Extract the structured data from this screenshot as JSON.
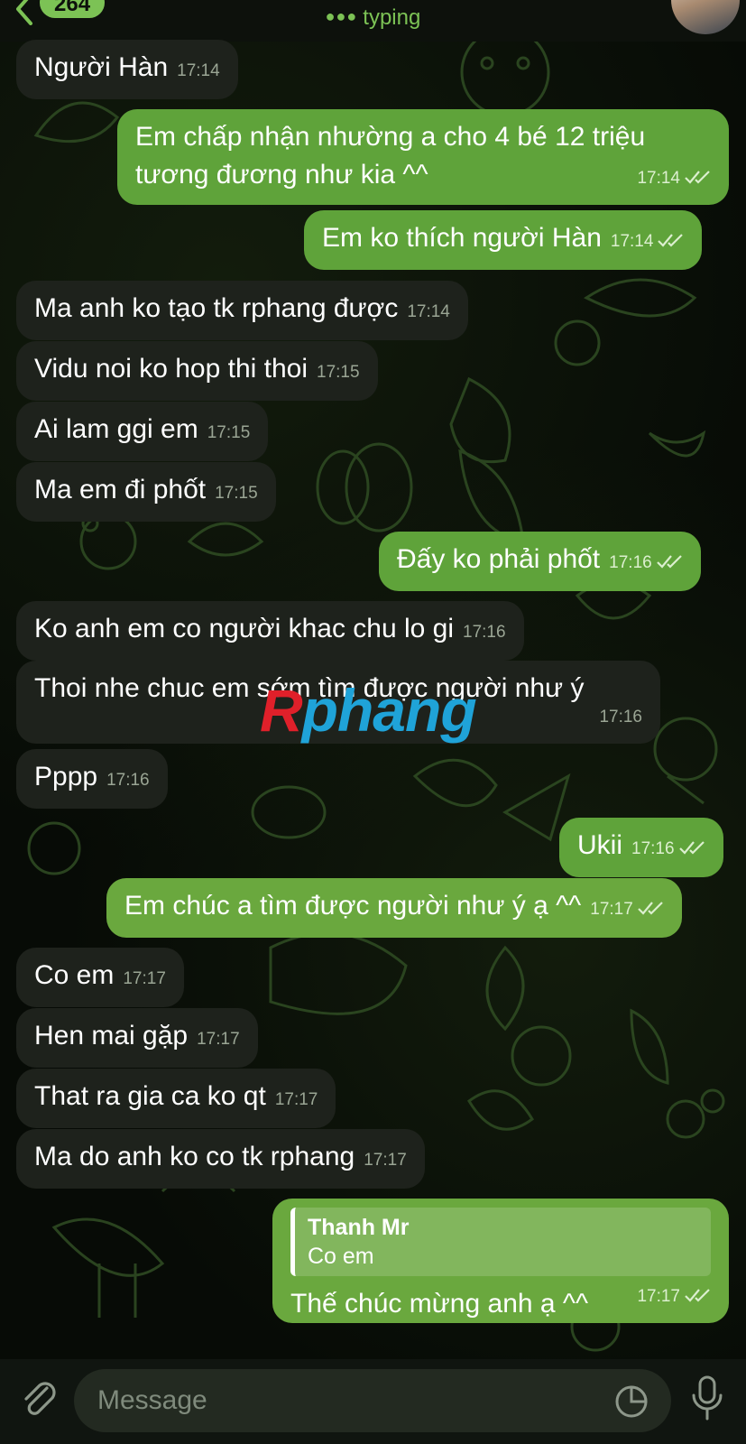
{
  "header": {
    "unread_count": "264",
    "status": "typing"
  },
  "messages": [
    {
      "dir": "in",
      "text": "Người Hàn",
      "time": "17:14"
    },
    {
      "dir": "out",
      "lines": [
        "Em chấp nhận nhường a cho 4 bé 12 triệu",
        "tương đương như kia ^^"
      ],
      "time": "17:14"
    },
    {
      "dir": "out",
      "text": "Em ko thích người Hàn",
      "time": "17:14"
    },
    {
      "dir": "in",
      "text": "Ma anh ko tạo tk rphang được",
      "time": "17:14"
    },
    {
      "dir": "in",
      "text": "Vidu noi ko hop thi thoi",
      "time": "17:15"
    },
    {
      "dir": "in",
      "text": "Ai lam ggi em",
      "time": "17:15"
    },
    {
      "dir": "in",
      "text": "Ma em đi phốt",
      "time": "17:15"
    },
    {
      "dir": "out",
      "text": "Đấy ko phải phốt",
      "time": "17:16"
    },
    {
      "dir": "in",
      "text": "Ko anh em co người khac chu lo gi",
      "time": "17:16"
    },
    {
      "dir": "in",
      "text": "Thoi nhe chuc em sớm tìm được người như ý",
      "time": "17:16"
    },
    {
      "dir": "in",
      "text": "Pppp",
      "time": "17:16"
    },
    {
      "dir": "out",
      "text": "Ukii",
      "time": "17:16"
    },
    {
      "dir": "out",
      "text": "Em chúc a tìm được người như ý ạ ^^",
      "time": "17:17"
    },
    {
      "dir": "in",
      "text": "Co em",
      "time": "17:17"
    },
    {
      "dir": "in",
      "text": "Hen mai gặp",
      "time": "17:17"
    },
    {
      "dir": "in",
      "text": "That ra gia ca ko qt",
      "time": "17:17"
    },
    {
      "dir": "in",
      "text": "Ma do anh ko co tk rphang",
      "time": "17:17"
    },
    {
      "dir": "out",
      "reply_to": {
        "name": "Thanh Mr",
        "text": "Co em"
      },
      "text": "Thế chúc mừng anh ạ ^^",
      "time": "17:17"
    }
  ],
  "watermark": {
    "first": "R",
    "rest": "phang"
  },
  "input": {
    "placeholder": "Message"
  },
  "colors": {
    "outgoing": "#5fa33a",
    "incoming": "#1e221c",
    "accent": "#7cc255"
  }
}
